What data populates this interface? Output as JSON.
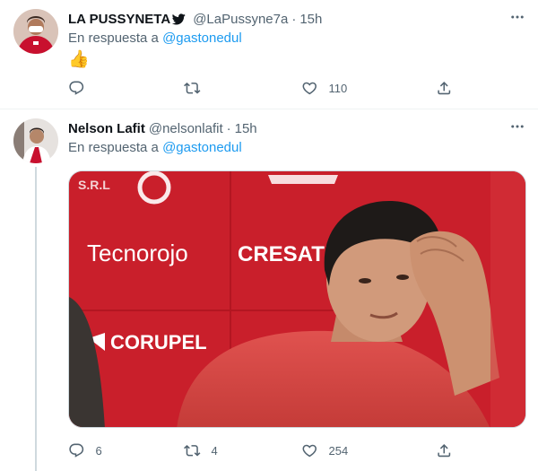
{
  "tweets": [
    {
      "name": "LA PUSSYNETA",
      "handle": "@LaPussyne7a",
      "dot": "·",
      "time": "15h",
      "reply_prefix": "En respuesta a",
      "reply_to": "@gastonedul",
      "body_emoji": "👍",
      "verified_icon": "bird-icon",
      "actions": {
        "reply": "",
        "retweet": "",
        "like": "110"
      },
      "colors": {
        "avatar_bg": "#c8102e"
      }
    },
    {
      "name": "Nelson Lafit",
      "handle": "@nelsonlafit",
      "dot": "·",
      "time": "15h",
      "reply_prefix": "En respuesta a",
      "reply_to": "@gastonedul",
      "media": {
        "sign_left": "Tecnorojo",
        "sign_right": "CRESATI",
        "sign_bottom": "CORUPEL",
        "sign_top": "S.R.L"
      },
      "actions": {
        "reply": "6",
        "retweet": "4",
        "like": "254"
      }
    }
  ],
  "colors": {
    "accent": "#1d9bf0",
    "muted": "#536471",
    "text": "#0f1419",
    "media_red": "#c81e2a"
  },
  "icons": {
    "reply": "speech-bubble-icon",
    "retweet": "retweet-arrows-icon",
    "like": "heart-icon",
    "share": "share-upload-icon",
    "more": "more-dots-icon"
  }
}
